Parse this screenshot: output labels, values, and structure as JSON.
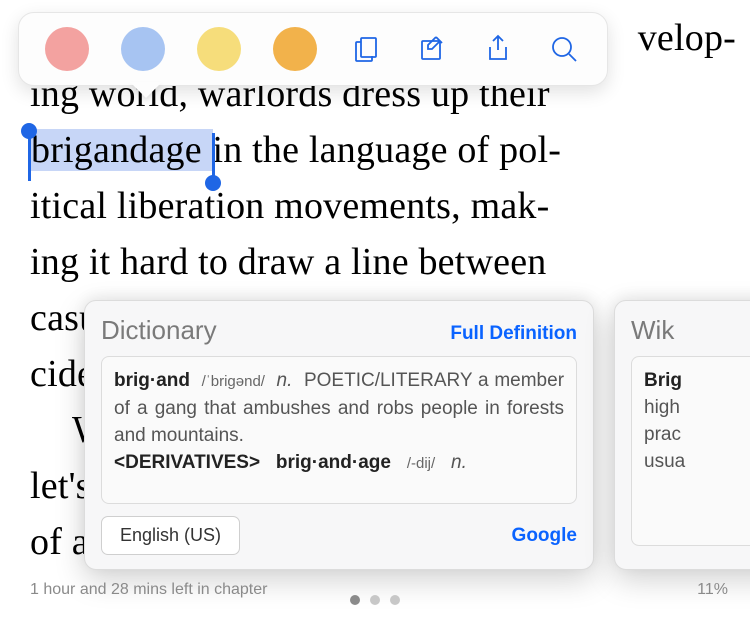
{
  "toolbar": {
    "colors": [
      "#f3a2a0",
      "#a7c4f2",
      "#f6dd7b",
      "#f2b24b"
    ],
    "icons": [
      "copy-icon",
      "note-icon",
      "share-icon",
      "search-icon"
    ]
  },
  "book": {
    "line1_pre": "",
    "line1_post": "velop-",
    "line2_pre": "ing world, warlords dress up their",
    "selected_word": "brigandage",
    "line3_post": " in the language of pol-",
    "line4": "itical liberation movements, mak-",
    "line5": "ing it hard to draw a line between",
    "line6": "casual violence and political homi-",
    "line7": "cide.",
    "line8_pre": "What is Ignatieff's argument",
    "line9": "let's call it the Soup Defense? First",
    "line10": "of all, there is no line to be drawn."
  },
  "dictionary": {
    "title": "Dictionary",
    "full_def": "Full Definition",
    "headword": "brig·and",
    "pron1": "/ˈbrigənd/",
    "pos1": "n.",
    "sense1_pre": "POETIC/LITERARY a member of a gang that ambushes and robs people in forests and mountains.",
    "deriv_label": "<DERIVATIVES>",
    "deriv_word": "brig·and·age",
    "pron2": "/-dij/",
    "pos2": "n.",
    "lang_button": "English (US)",
    "google": "Google"
  },
  "wiki": {
    "title": "Wik",
    "body_bold": "Brig",
    "body_l2": "high",
    "body_l3": "prac",
    "body_l4": "usua"
  },
  "footer": {
    "left": "1 hour and 28 mins left in chapter",
    "right": "11%"
  }
}
